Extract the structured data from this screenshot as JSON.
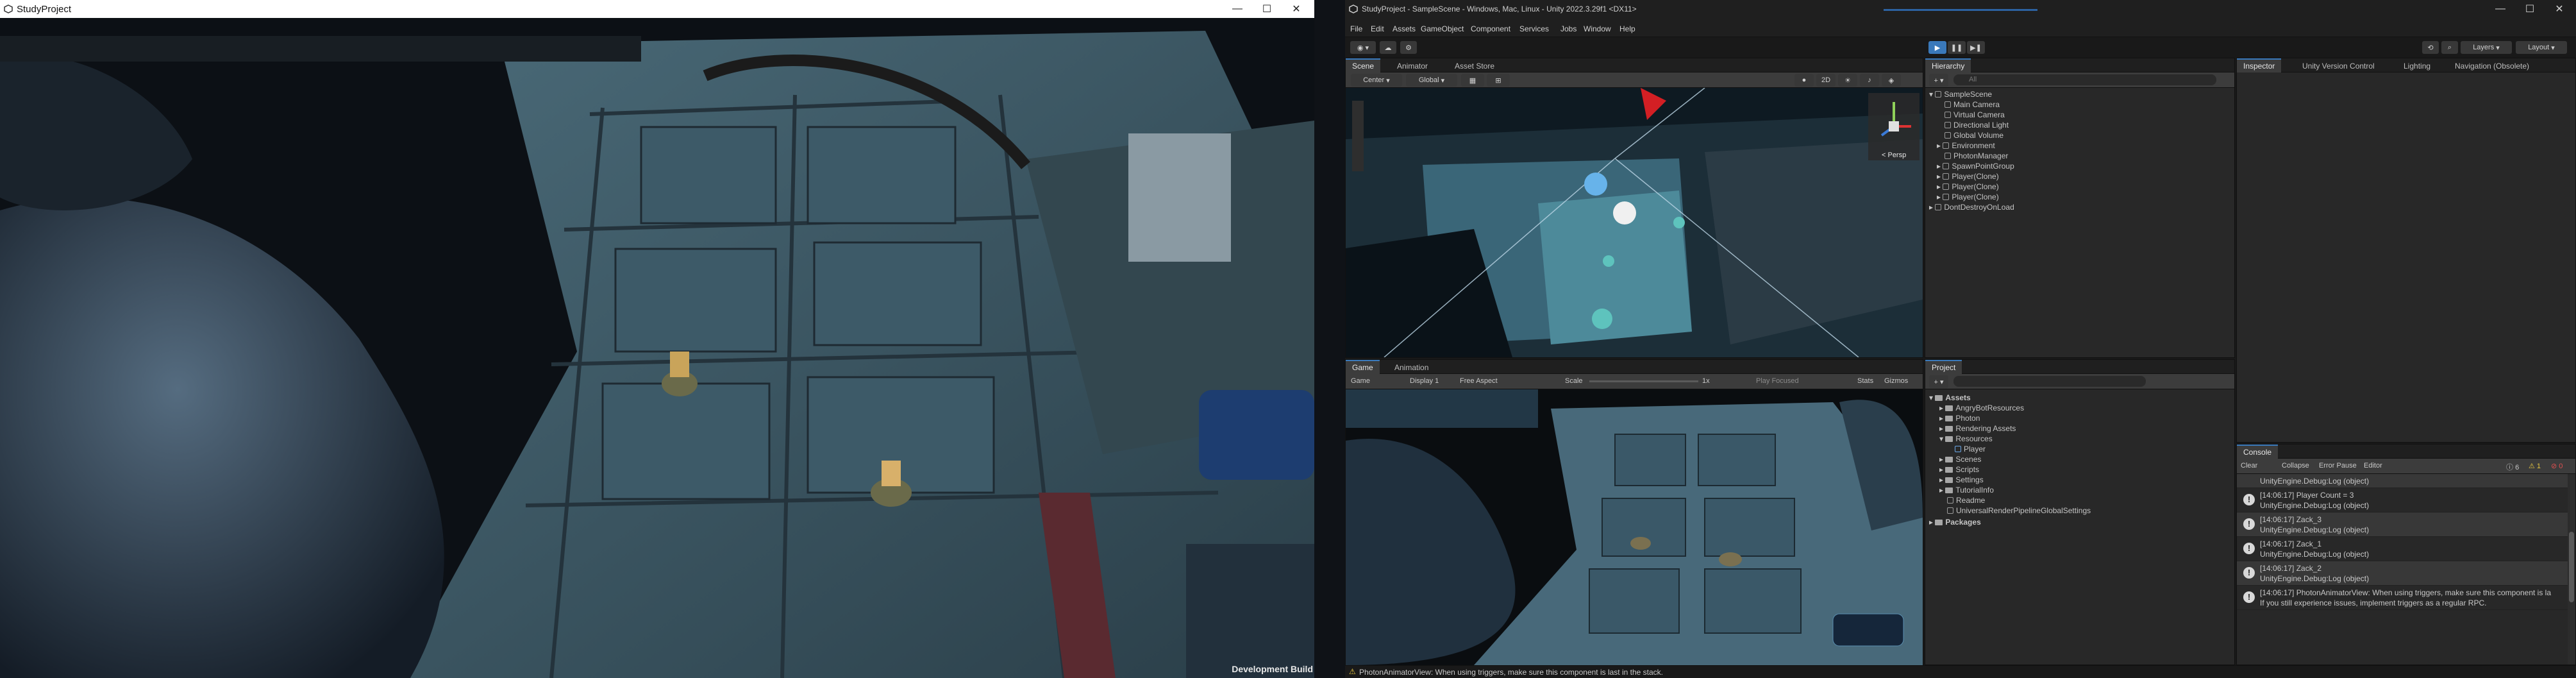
{
  "left_window": {
    "title": "StudyProject",
    "dev_build_label": "Development Build",
    "controls": {
      "minimize": "—",
      "maximize": "☐",
      "close": "✕"
    }
  },
  "editor": {
    "title": "StudyProject - SampleScene - Windows, Mac, Linux - Unity 2022.3.29f1 <DX11>",
    "menu": [
      "File",
      "Edit",
      "Assets",
      "GameObject",
      "Component",
      "Services",
      "Jobs",
      "Window",
      "Help"
    ],
    "toolbar": {
      "layers_label": "Layers",
      "layout_label": "Layout"
    },
    "scene_panel": {
      "tabs": [
        "Scene",
        "Animator",
        "Asset Store"
      ],
      "center_label": "Center",
      "global_label": "Global",
      "persp_label": "< Persp"
    },
    "game_panel": {
      "tabs": [
        "Game",
        "Animation"
      ],
      "game_dropdown": "Game",
      "display": "Display 1",
      "aspect": "Free Aspect",
      "scale_label": "Scale",
      "scale_value": "1x",
      "play_focused": "Play Focused",
      "stats": "Stats",
      "gizmos": "Gizmos"
    },
    "hierarchy": {
      "tab": "Hierarchy",
      "search_placeholder": "All",
      "items": [
        {
          "label": "SampleScene",
          "depth": 0
        },
        {
          "label": "Main Camera",
          "depth": 2
        },
        {
          "label": "Virtual Camera",
          "depth": 2
        },
        {
          "label": "Directional Light",
          "depth": 2
        },
        {
          "label": "Global Volume",
          "depth": 2
        },
        {
          "label": "Environment",
          "depth": 2
        },
        {
          "label": "PhotonManager",
          "depth": 2
        },
        {
          "label": "SpawnPointGroup",
          "depth": 2
        },
        {
          "label": "Player(Clone)",
          "depth": 2
        },
        {
          "label": "Player(Clone)",
          "depth": 2
        },
        {
          "label": "Player(Clone)",
          "depth": 2
        },
        {
          "label": "DontDestroyOnLoad",
          "depth": 0
        }
      ]
    },
    "project": {
      "tab": "Project",
      "items": [
        {
          "label": "Assets",
          "depth": 0,
          "bold": true
        },
        {
          "label": "AngryBotResources",
          "depth": 1
        },
        {
          "label": "Photon",
          "depth": 1
        },
        {
          "label": "Rendering Assets",
          "depth": 1
        },
        {
          "label": "Resources",
          "depth": 1
        },
        {
          "label": "Player",
          "depth": 2
        },
        {
          "label": "Scenes",
          "depth": 1
        },
        {
          "label": "Scripts",
          "depth": 1
        },
        {
          "label": "Settings",
          "depth": 1
        },
        {
          "label": "TutorialInfo",
          "depth": 1
        },
        {
          "label": "Readme",
          "depth": 1
        },
        {
          "label": "UniversalRenderPipelineGlobalSettings",
          "depth": 1
        },
        {
          "label": "Packages",
          "depth": 0,
          "bold": true
        }
      ]
    },
    "inspector": {
      "tabs": [
        "Inspector",
        "Unity Version Control",
        "Lighting",
        "Navigation (Obsolete)"
      ]
    },
    "console": {
      "tab": "Console",
      "buttons": [
        "Clear",
        "Collapse",
        "Error Pause",
        "Editor"
      ],
      "counts": {
        "info": "6",
        "warn": "1",
        "error": "0"
      },
      "logs": [
        {
          "line1": "",
          "line2": "UnityEngine.Debug:Log (object)"
        },
        {
          "line1": "[14:06:17] Player Count = 3",
          "line2": "UnityEngine.Debug:Log (object)"
        },
        {
          "line1": "[14:06:17] Zack_3",
          "line2": "UnityEngine.Debug:Log (object)"
        },
        {
          "line1": "[14:06:17] Zack_1",
          "line2": "UnityEngine.Debug:Log (object)"
        },
        {
          "line1": "[14:06:17] Zack_2",
          "line2": "UnityEngine.Debug:Log (object)"
        },
        {
          "line1": "[14:06:17] PhotonAnimatorView: When using triggers, make sure this component is la",
          "line2": "If you still experience issues, implement triggers as a regular RPC."
        }
      ]
    },
    "status_message": "PhotonAnimatorView: When using triggers, make sure this component is last in the stack."
  },
  "colors": {
    "accent": "#3a79bb",
    "panel": "#282828",
    "panel_dark": "#191919"
  }
}
